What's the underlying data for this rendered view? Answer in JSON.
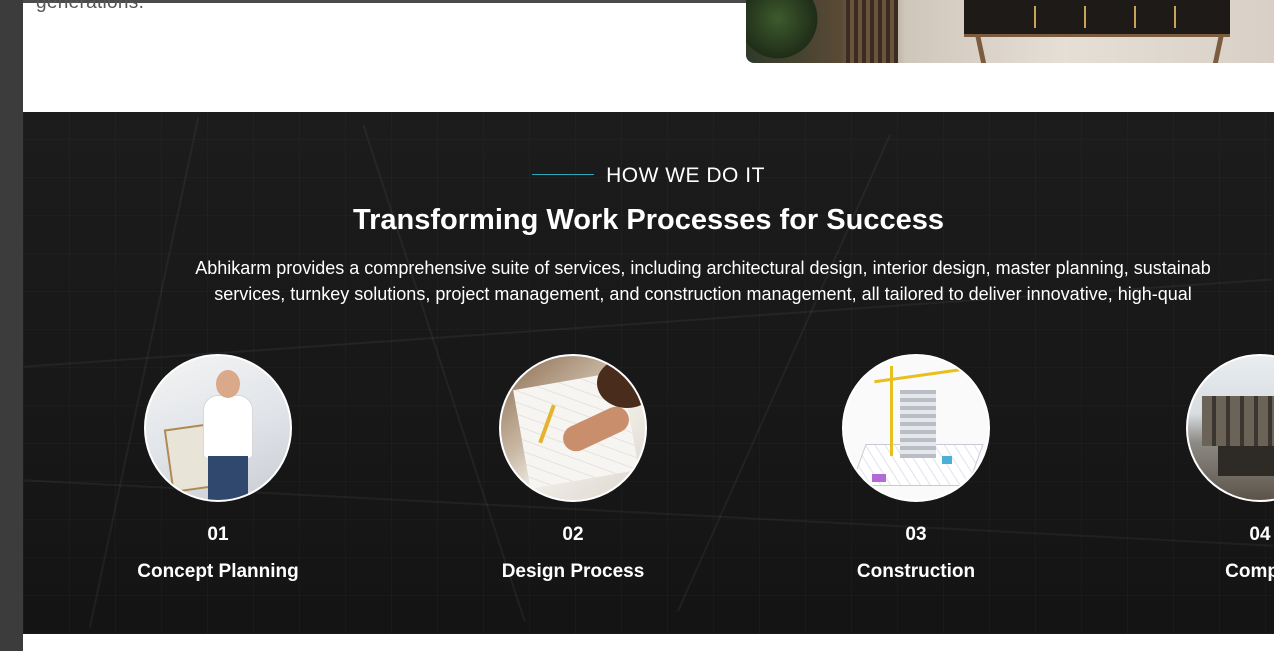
{
  "previous_section": {
    "text_fragment": "generations."
  },
  "process_section": {
    "eyebrow": "HOW WE DO IT",
    "heading": "Transforming Work Processes for Success",
    "description_line1": "Abhikarm provides a comprehensive suite of services, including architectural design, interior design, master planning, sustainab",
    "description_line2": "services, turnkey solutions, project management, and construction management, all tailored to deliver innovative, high-qual",
    "accent_color": "#2aa7b8",
    "steps": [
      {
        "number": "01",
        "title": "Concept Planning"
      },
      {
        "number": "02",
        "title": "Design Process"
      },
      {
        "number": "03",
        "title": "Construction"
      },
      {
        "number": "04",
        "title": "Comple"
      }
    ]
  }
}
